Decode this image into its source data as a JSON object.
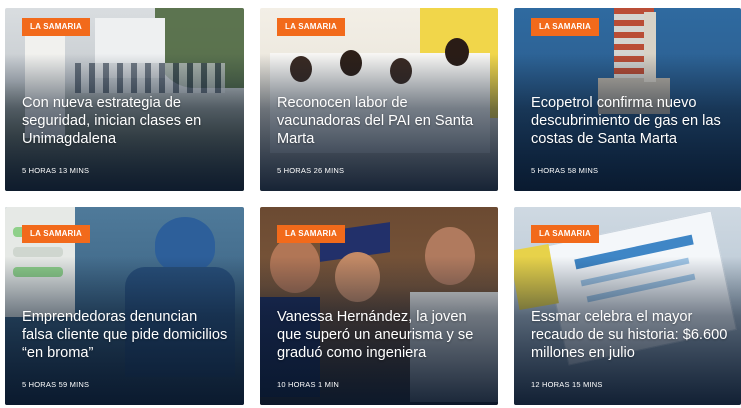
{
  "articles": [
    {
      "category": "LA SAMARIA",
      "title": "Con nueva estrategia de seguridad, inician clases en Unimagdalena",
      "time": "5 HORAS 13 MINS",
      "scene": "campus"
    },
    {
      "category": "LA SAMARIA",
      "title": "Reconocen labor de vacunadoras del PAI en Santa Marta",
      "time": "5 HORAS 26 MINS",
      "scene": "group"
    },
    {
      "category": "LA SAMARIA",
      "title": "Ecopetrol confirma nuevo descubrimiento de gas en las costas de Santa Marta",
      "time": "5 HORAS 58 MINS",
      "scene": "offshore"
    },
    {
      "category": "LA SAMARIA",
      "title": "Emprendedoras denuncian falsa cliente que pide domicilios “en broma”",
      "time": "5 HORAS 59 MINS",
      "scene": "delivery"
    },
    {
      "category": "LA SAMARIA",
      "title": "Vanessa Hernández, la joven que superó un aneurisma y se graduó como ingeniera",
      "time": "10 HORAS 1 MIN",
      "scene": "graduation"
    },
    {
      "category": "LA SAMARIA",
      "title": "Essmar celebra el mayor recaudo de su historia: $6.600 millones en julio",
      "time": "12 HORAS 15 MINS",
      "scene": "bill"
    }
  ]
}
